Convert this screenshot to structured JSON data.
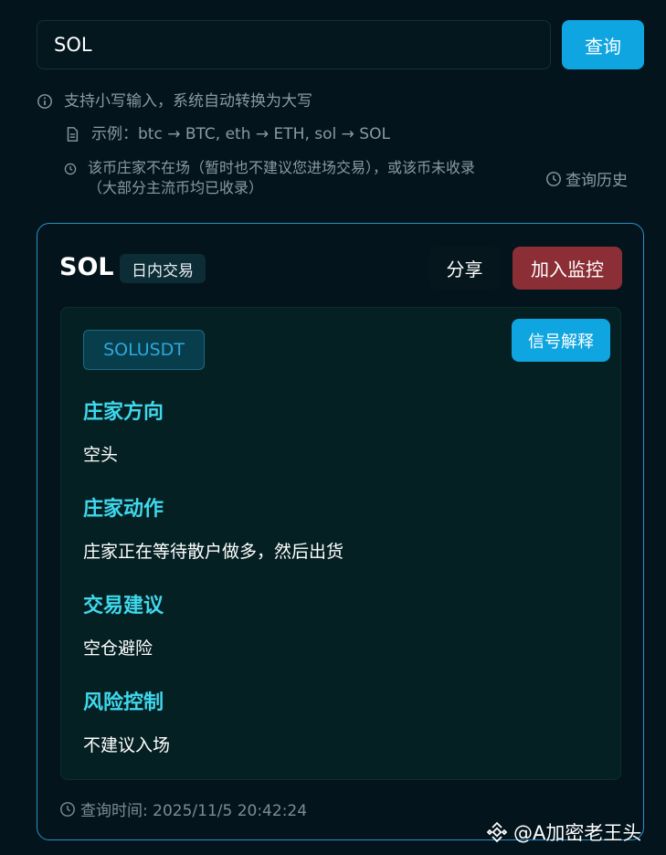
{
  "search": {
    "value": "SOL",
    "button_label": "查询"
  },
  "hints": {
    "line1": "支持小写输入，系统自动转换为大写",
    "line2": "示例：btc → BTC, eth → ETH, sol → SOL",
    "line3a": "该币庄家不在场（暂时也不建议您进场交易），或该币未收录",
    "line3b": "（大部分主流币均已收录）",
    "history_label": "查询历史"
  },
  "result": {
    "coin": "SOL",
    "mode_badge": "日内交易",
    "share_label": "分享",
    "monitor_label": "加入监控",
    "symbol": "SOLUSDT",
    "signal_label": "信号解释",
    "sections": [
      {
        "title": "庄家方向",
        "value": "空头"
      },
      {
        "title": "庄家动作",
        "value": "庄家正在等待散户做多，然后出货"
      },
      {
        "title": "交易建议",
        "value": "空仓避险"
      },
      {
        "title": "风险控制",
        "value": "不建议入场"
      }
    ],
    "query_time": "查询时间: 2025/11/5 20:42:24"
  },
  "watermark": "@A加密老王头",
  "icons": {
    "info": "info-circle-icon",
    "doc": "document-icon",
    "clock": "clock-icon",
    "brand": "binance-logo-icon"
  },
  "colors": {
    "accent": "#0ea5e0",
    "danger": "#8b2e35",
    "heading": "#3fd8ec"
  }
}
